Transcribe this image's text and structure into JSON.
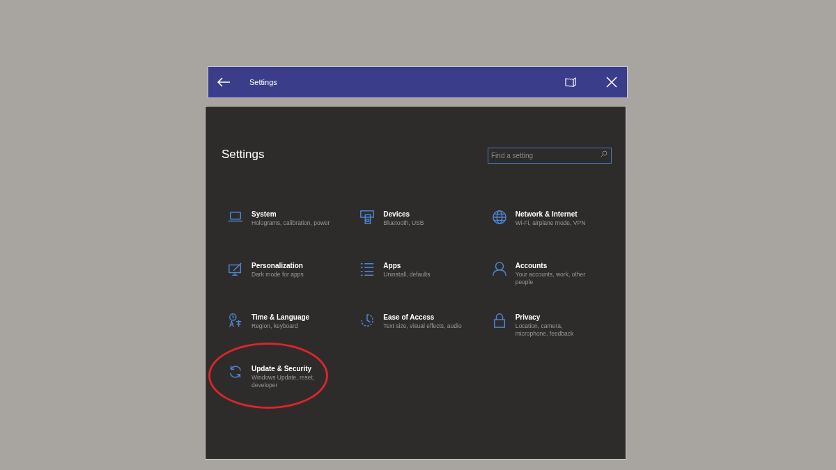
{
  "titlebar": {
    "title": "Settings"
  },
  "page": {
    "heading": "Settings",
    "search": {
      "placeholder": "Find a setting"
    }
  },
  "items": [
    {
      "title": "System",
      "subtitle": "Holograms, calibration, power",
      "circled": false
    },
    {
      "title": "Devices",
      "subtitle": "Bluetooth, USB",
      "circled": false
    },
    {
      "title": "Network & Internet",
      "subtitle": "Wi-Fi, airplane mode, VPN",
      "circled": false
    },
    {
      "title": "Personalization",
      "subtitle": "Dark mode for apps",
      "circled": false
    },
    {
      "title": "Apps",
      "subtitle": "Uninstall, defaults",
      "circled": false
    },
    {
      "title": "Accounts",
      "subtitle": "Your accounts, work, other people",
      "circled": false
    },
    {
      "title": "Time & Language",
      "subtitle": "Region, keyboard",
      "circled": false
    },
    {
      "title": "Ease of Access",
      "subtitle": "Text size, visual effects, audio",
      "circled": false
    },
    {
      "title": "Privacy",
      "subtitle": "Location, camera, microphone, feedback",
      "circled": false
    },
    {
      "title": "Update & Security",
      "subtitle": "Windows Update, reset, developer",
      "circled": true
    }
  ]
}
